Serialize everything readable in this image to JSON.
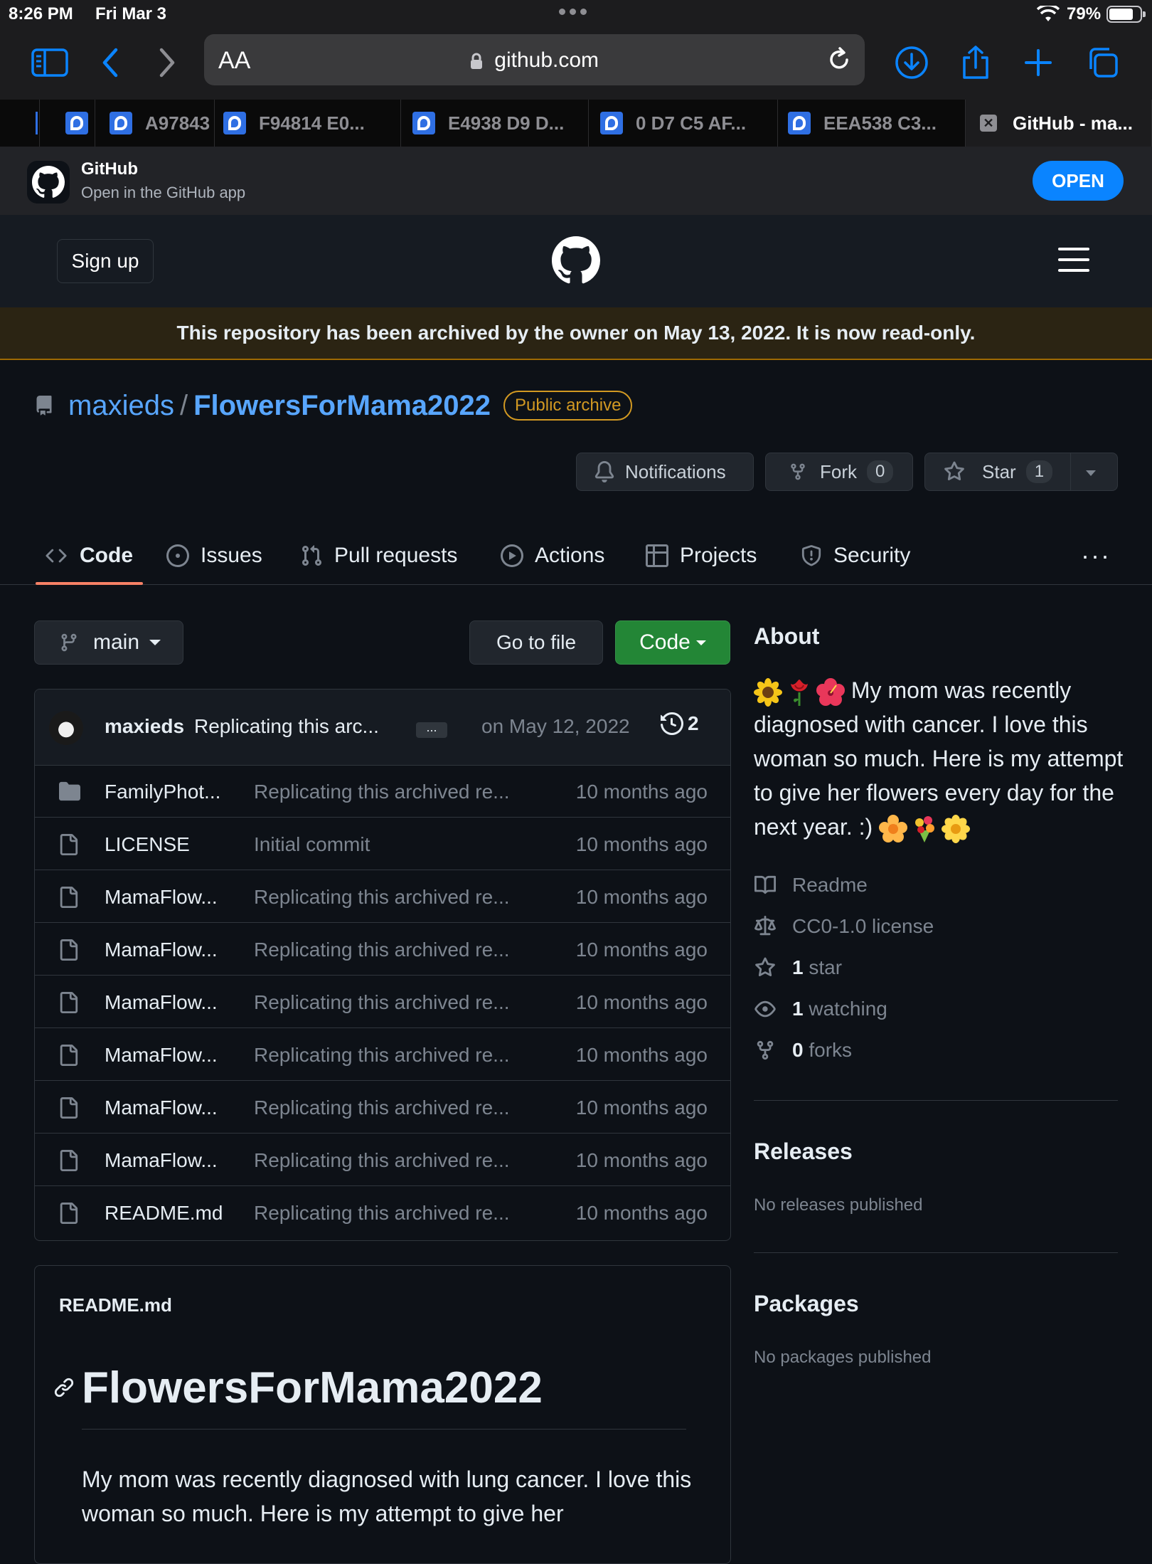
{
  "status_bar": {
    "time": "8:26 PM",
    "date": "Fri Mar 3",
    "battery": "79%",
    "battery_level": 0.79
  },
  "browser": {
    "text_size_label": "AA",
    "url": "github.com",
    "tabs": [
      {
        "label": "A97843"
      },
      {
        "label": "F94814 E0..."
      },
      {
        "label": "E4938 D9 D..."
      },
      {
        "label": "0 D7 C5 AF..."
      },
      {
        "label": "EEA538 C3..."
      },
      {
        "label": "GitHub - ma..."
      }
    ]
  },
  "app_banner": {
    "title": "GitHub",
    "subtitle": "Open in the GitHub app",
    "open_label": "OPEN"
  },
  "header": {
    "signup_label": "Sign up"
  },
  "archive_notice": "This repository has been archived by the owner on May 13, 2022. It is now read-only.",
  "repo": {
    "owner": "maxieds",
    "separator": "/",
    "name": "FlowersForMama2022",
    "badge": "Public archive",
    "actions": {
      "notifications_label": "Notifications",
      "fork_label": "Fork",
      "fork_count": "0",
      "star_label": "Star",
      "star_count": "1"
    }
  },
  "repo_nav": {
    "code": "Code",
    "issues": "Issues",
    "pull_requests": "Pull requests",
    "actions": "Actions",
    "projects": "Projects",
    "security": "Security",
    "more": "···"
  },
  "toolbar": {
    "branch": "main",
    "goto_file": "Go to file",
    "code_button": "Code"
  },
  "latest_commit": {
    "author": "maxieds",
    "message": "Replicating this arc...",
    "ellipsis": "...",
    "date": "on May 12, 2022",
    "history_count": "2"
  },
  "files": [
    {
      "type": "folder",
      "name": "FamilyPhot...",
      "message": "Replicating this archived re...",
      "age": "10 months ago"
    },
    {
      "type": "file",
      "name": "LICENSE",
      "message": "Initial commit",
      "age": "10 months ago"
    },
    {
      "type": "file",
      "name": "MamaFlow...",
      "message": "Replicating this archived re...",
      "age": "10 months ago"
    },
    {
      "type": "file",
      "name": "MamaFlow...",
      "message": "Replicating this archived re...",
      "age": "10 months ago"
    },
    {
      "type": "file",
      "name": "MamaFlow...",
      "message": "Replicating this archived re...",
      "age": "10 months ago"
    },
    {
      "type": "file",
      "name": "MamaFlow...",
      "message": "Replicating this archived re...",
      "age": "10 months ago"
    },
    {
      "type": "file",
      "name": "MamaFlow...",
      "message": "Replicating this archived re...",
      "age": "10 months ago"
    },
    {
      "type": "file",
      "name": "MamaFlow...",
      "message": "Replicating this archived re...",
      "age": "10 months ago"
    },
    {
      "type": "file",
      "name": "README.md",
      "message": "Replicating this archived re...",
      "age": "10 months ago"
    }
  ],
  "readme": {
    "filename": "README.md",
    "heading": "FlowersForMama2022",
    "body": "My mom was recently diagnosed with lung cancer. I love this woman so much. Here is my attempt to give her"
  },
  "about": {
    "heading": "About",
    "description": "My mom was recently diagnosed with cancer. I love this woman so much. Here is my attempt to give her flowers every day for the next year. :)",
    "readme_label": "Readme",
    "license_label": "CC0-1.0 license",
    "stars_count": "1",
    "stars_label": "star",
    "watching_count": "1",
    "watching_label": "watching",
    "forks_count": "0",
    "forks_label": "forks"
  },
  "releases": {
    "heading": "Releases",
    "note": "No releases published"
  },
  "packages": {
    "heading": "Packages",
    "note": "No packages published"
  },
  "colors": {
    "accent_link": "#58a6ff",
    "archive_badge": "#d29922",
    "code_button": "#238636",
    "nav_underline": "#f78166",
    "ios_blue": "#0a84ff"
  }
}
